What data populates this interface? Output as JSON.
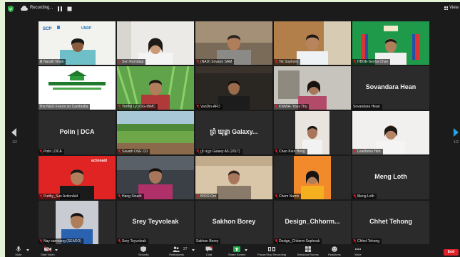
{
  "topbar": {
    "recording_label": "Recording...",
    "view_label": "View"
  },
  "pagination": {
    "left": "1/2",
    "right": "1/2"
  },
  "tiles": [
    {
      "id": "t1",
      "name": "Narath Nhan",
      "muted": false
    },
    {
      "id": "t2",
      "name": "Sen Rumdaul",
      "muted": true
    },
    {
      "id": "t3",
      "name": "(NAD) Sovann SAM",
      "muted": true
    },
    {
      "id": "t4",
      "name": "Tet Sophorn",
      "muted": true
    },
    {
      "id": "t5",
      "name": "HBOE-Seyha Chan",
      "muted": true
    },
    {
      "id": "t6",
      "name": "The NGO Forum on Cambodia",
      "muted": false,
      "active": true,
      "logo_title": "The NGO Forum on Cambodia"
    },
    {
      "id": "t7",
      "name": "Yorthd Ly VSG-IBMC",
      "muted": true
    },
    {
      "id": "t8",
      "name": "VanDin-AFD",
      "muted": true
    },
    {
      "id": "t9",
      "name": "KWWA- Yous Thy",
      "muted": true
    },
    {
      "id": "t10",
      "display": "Sovandara Hean",
      "name": "Sovandara Hean",
      "muted": false
    },
    {
      "id": "t11",
      "display": "Polin | DCA",
      "name": "Polin | DCA",
      "muted": true
    },
    {
      "id": "t12",
      "name": "Savath OSE CD",
      "muted": true
    },
    {
      "id": "t13",
      "display": "ព្រំ ឃុន្ថា Galaxy...",
      "name": "ព្រំ ឃុន្ថា Galaxy A5 (2017)",
      "muted": true
    },
    {
      "id": "t14",
      "name": "Chao Kien Heng",
      "muted": true
    },
    {
      "id": "t15",
      "name": "Leakhena Hen",
      "muted": true
    },
    {
      "id": "t16",
      "name": "Putthy_Sun ActionAid",
      "muted": true,
      "brand": "actionaid"
    },
    {
      "id": "t17",
      "name": "Hang Sinath",
      "muted": true
    },
    {
      "id": "t18",
      "name": "BIOO-Om",
      "muted": true
    },
    {
      "id": "t19",
      "name": "Chem Narrin",
      "muted": true
    },
    {
      "id": "t20",
      "display": "Meng Loth",
      "name": "Meng Loth",
      "muted": true
    },
    {
      "id": "t21",
      "name": "Nay samnang (SEADO)",
      "muted": true
    },
    {
      "id": "t22",
      "display": "Srey Teyvoleak",
      "name": "Srey Teyvoleak",
      "muted": true
    },
    {
      "id": "t23",
      "display": "Sakhon Borey",
      "name": "Sakhon Borey",
      "muted": true
    },
    {
      "id": "t24",
      "display": "Design_Chhorm...",
      "name": "Design_Chhorm Sopheak",
      "muted": true
    },
    {
      "id": "t25",
      "display": "Chhet Tehong",
      "name": "Chhet Tehong",
      "muted": true
    }
  ],
  "toolbar": {
    "mute": "Mute",
    "stop_video": "Start Video",
    "security": "Security",
    "participants": "Participants",
    "participants_count": "27",
    "chat": "Chat",
    "share": "Share Screen",
    "record": "Pause/Stop Recording",
    "breakout": "Breakout Rooms",
    "reactions": "Reactions",
    "more": "More",
    "end": "End"
  },
  "colors": {
    "active_border": "#c9d93a",
    "end_button": "#e0212a",
    "muted_icon": "#e0212a"
  }
}
